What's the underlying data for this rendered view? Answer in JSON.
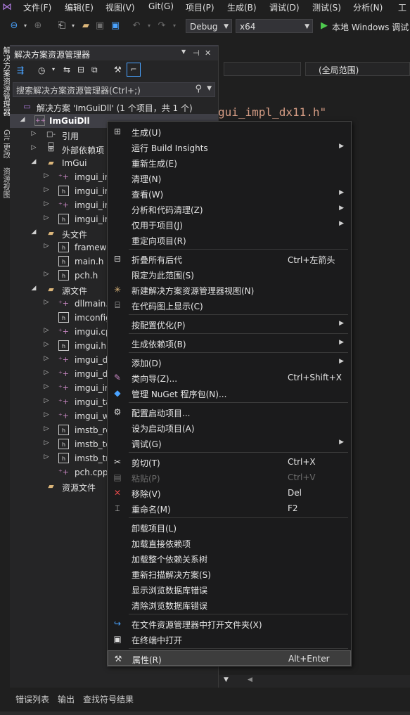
{
  "menubar": {
    "items": [
      "文件(F)",
      "编辑(E)",
      "视图(V)",
      "Git(G)",
      "项目(P)",
      "生成(B)",
      "调试(D)",
      "测试(S)",
      "分析(N)",
      "工"
    ]
  },
  "toolbar": {
    "config": "Debug",
    "platform": "x64",
    "run_label": "本地 Windows 调试"
  },
  "left_tabs": [
    "解决方案资源管理器",
    "Git 更改",
    "资源视图"
  ],
  "solution_explorer": {
    "title": "解决方案资源管理器",
    "search_placeholder": "搜索解决方案资源管理器(Ctrl+;)",
    "tree": [
      {
        "label": "解决方案 'ImGuiDll' (1 个项目，共 1 个)",
        "icon": "solution-icon"
      },
      {
        "label": "ImGuiDll",
        "icon": "project-icon"
      },
      {
        "label": "引用",
        "icon": "references-icon"
      },
      {
        "label": "外部依赖项",
        "icon": "external-deps-icon"
      },
      {
        "label": "ImGui",
        "icon": "folder-icon"
      },
      {
        "label": "imgui_in",
        "icon": "header-file-icon"
      },
      {
        "label": "imgui_in",
        "icon": "header-file-icon"
      },
      {
        "label": "imgui_in",
        "icon": "header-file-icon"
      },
      {
        "label": "imgui_in",
        "icon": "header-file-icon"
      },
      {
        "label": "头文件",
        "icon": "folder-icon"
      },
      {
        "label": "framewo",
        "icon": "header-file-icon"
      },
      {
        "label": "main.h",
        "icon": "header-file-icon"
      },
      {
        "label": "pch.h",
        "icon": "header-file-icon"
      },
      {
        "label": "源文件",
        "icon": "folder-icon"
      },
      {
        "label": "dllmain.",
        "icon": "cpp-file-icon"
      },
      {
        "label": "imconfig",
        "icon": "header-file-icon"
      },
      {
        "label": "imgui.cp",
        "icon": "cpp-file-icon"
      },
      {
        "label": "imgui.h",
        "icon": "header-file-icon"
      },
      {
        "label": "imgui_d",
        "icon": "cpp-file-icon"
      },
      {
        "label": "imgui_d",
        "icon": "cpp-file-icon"
      },
      {
        "label": "imgui_in",
        "icon": "cpp-file-icon"
      },
      {
        "label": "imgui_ta",
        "icon": "cpp-file-icon"
      },
      {
        "label": "imgui_w",
        "icon": "cpp-file-icon"
      },
      {
        "label": "imstb_re",
        "icon": "header-file-icon"
      },
      {
        "label": "imstb_te",
        "icon": "header-file-icon"
      },
      {
        "label": "imstb_tr",
        "icon": "header-file-icon"
      },
      {
        "label": "pch.cpp",
        "icon": "cpp-file-icon"
      },
      {
        "label": "资源文件",
        "icon": "folder-icon"
      }
    ]
  },
  "editor": {
    "scope": "(全局范围)",
    "code_fragment": "gui_impl_dx11.h\""
  },
  "context_menu": {
    "items": [
      {
        "label": "生成(U)",
        "icon": "build-icon"
      },
      {
        "label": "运行 Build Insights",
        "submenu": true
      },
      {
        "label": "重新生成(E)"
      },
      {
        "label": "清理(N)"
      },
      {
        "label": "查看(W)",
        "submenu": true
      },
      {
        "label": "分析和代码清理(Z)",
        "submenu": true
      },
      {
        "label": "仅用于项目(J)",
        "submenu": true
      },
      {
        "label": "重定向项目(R)"
      },
      {
        "label": "折叠所有后代",
        "shortcut": "Ctrl+左箭头",
        "icon": "collapse-icon"
      },
      {
        "label": "限定为此范围(S)"
      },
      {
        "label": "新建解决方案资源管理器视图(N)",
        "icon": "new-view-icon"
      },
      {
        "label": "在代码图上显示(C)",
        "icon": "code-map-icon"
      },
      {
        "label": "按配置优化(P)",
        "submenu": true
      },
      {
        "label": "生成依赖项(B)",
        "submenu": true
      },
      {
        "label": "添加(D)",
        "submenu": true
      },
      {
        "label": "类向导(Z)...",
        "shortcut": "Ctrl+Shift+X",
        "icon": "class-wizard-icon"
      },
      {
        "label": "管理 NuGet 程序包(N)...",
        "icon": "nuget-icon"
      },
      {
        "label": "配置启动项目...",
        "icon": "gear-icon"
      },
      {
        "label": "设为启动项目(A)"
      },
      {
        "label": "调试(G)",
        "submenu": true
      },
      {
        "label": "剪切(T)",
        "shortcut": "Ctrl+X",
        "icon": "scissors-icon"
      },
      {
        "label": "粘贴(P)",
        "shortcut": "Ctrl+V",
        "icon": "paste-icon",
        "disabled": true
      },
      {
        "label": "移除(V)",
        "shortcut": "Del",
        "icon": "remove-icon"
      },
      {
        "label": "重命名(M)",
        "shortcut": "F2",
        "icon": "rename-icon"
      },
      {
        "label": "卸载项目(L)"
      },
      {
        "label": "加载直接依赖项"
      },
      {
        "label": "加载整个依赖关系树"
      },
      {
        "label": "重新扫描解决方案(S)"
      },
      {
        "label": "显示浏览数据库错误"
      },
      {
        "label": "清除浏览数据库错误"
      },
      {
        "label": "在文件资源管理器中打开文件夹(X)",
        "icon": "open-folder-icon"
      },
      {
        "label": "在终端中打开",
        "icon": "terminal-icon"
      },
      {
        "label": "属性(R)",
        "shortcut": "Alt+Enter",
        "icon": "properties-icon"
      }
    ]
  },
  "bottom_tabs": [
    "错误列表",
    "输出",
    "查找符号结果"
  ]
}
